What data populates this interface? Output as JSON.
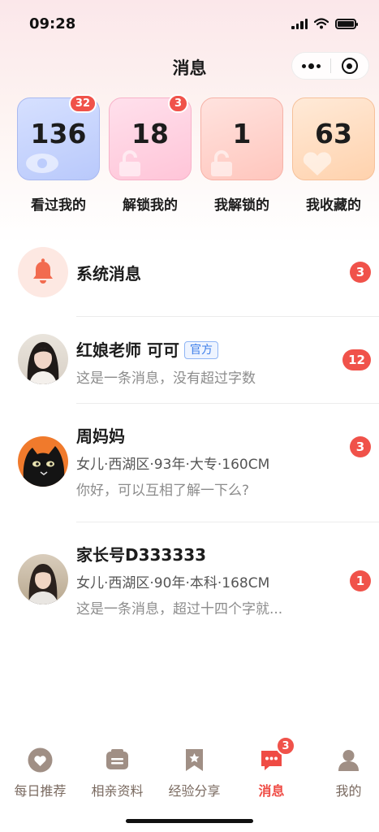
{
  "status_bar": {
    "time": "09:28"
  },
  "header": {
    "title": "消息"
  },
  "stats": [
    {
      "value": "136",
      "label": "看过我的",
      "badge": "32"
    },
    {
      "value": "18",
      "label": "解锁我的",
      "badge": "3"
    },
    {
      "value": "1",
      "label": "我解锁的",
      "badge": ""
    },
    {
      "value": "63",
      "label": "我收藏的",
      "badge": ""
    }
  ],
  "messages": [
    {
      "name": "系统消息",
      "count": "3"
    },
    {
      "name": "红娘老师 可可",
      "tag": "官方",
      "preview": "这是一条消息，没有超过字数",
      "count": "12"
    },
    {
      "name": "周妈妈",
      "detail": "女儿·西湖区·93年·大专·160CM",
      "preview": "你好，可以互相了解一下么?",
      "count": "3"
    },
    {
      "name": "家长号D333333",
      "detail": "女儿·西湖区·90年·本科·168CM",
      "preview": "这是一条消息，超过十四个字就...",
      "count": "1"
    }
  ],
  "tabs": [
    {
      "label": "每日推荐",
      "icon": "heart-icon"
    },
    {
      "label": "相亲资料",
      "icon": "profile-card-icon"
    },
    {
      "label": "经验分享",
      "icon": "bookmark-star-icon"
    },
    {
      "label": "消息",
      "icon": "chat-bubble-icon",
      "badge": "3",
      "active": true
    },
    {
      "label": "我的",
      "icon": "user-icon"
    }
  ],
  "colors": {
    "accent": "#f0524a",
    "tab_inactive": "#a08f85",
    "official_tag": "#3d7ee9"
  }
}
